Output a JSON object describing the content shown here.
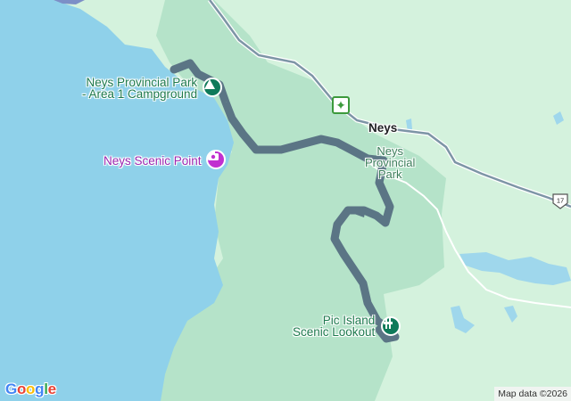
{
  "map": {
    "places": {
      "campground": "Neys Provincial Park\n- Area 1 Campground",
      "scenic_point": "Neys Scenic Point",
      "town": "Neys",
      "park": "Neys\nProvincial\nPark",
      "lookout": "Pic Island\nScenic Lookout"
    },
    "highway_shield": "17",
    "attribution": "Map data ©2026",
    "google_logo": [
      "G",
      "o",
      "o",
      "g",
      "l",
      "e"
    ],
    "colors": {
      "water": "#8fd1ea",
      "land": "#cdeed7",
      "park": "#b3e2c6",
      "route": "#5b7585",
      "road": "#7d95a6",
      "poi_green": "#0f7a5a",
      "poi_purple": "#c130d0",
      "logo": [
        "#4285F4",
        "#EA4335",
        "#FBBC05",
        "#4285F4",
        "#34A853",
        "#EA4335"
      ]
    },
    "icons": [
      "campground-icon",
      "camera-icon",
      "viewpoint-icon",
      "maple-leaf-icon",
      "highway-shield-icon"
    ]
  }
}
